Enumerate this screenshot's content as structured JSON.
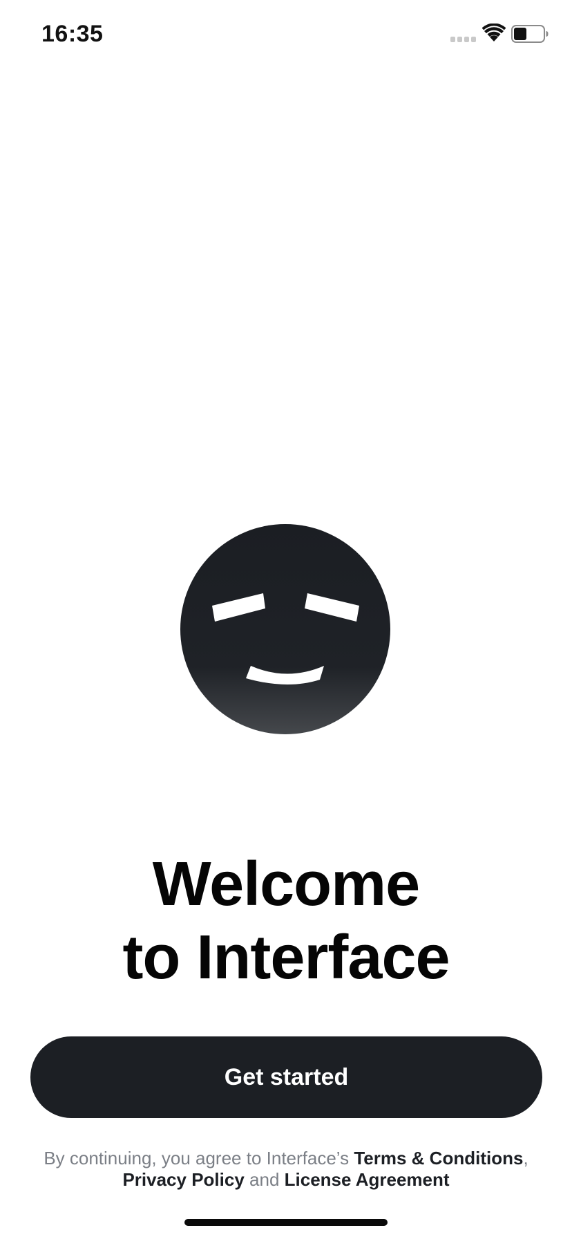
{
  "status_bar": {
    "time": "16:35",
    "signal_icon": "cellular-signal-icon",
    "wifi_icon": "wifi-icon",
    "battery_icon": "battery-icon",
    "battery_level": 0.45
  },
  "hero": {
    "mascot_icon": "smiling-face-icon",
    "title_line1": "Welcome",
    "title_line2": "to Interface"
  },
  "cta": {
    "label": "Get started"
  },
  "legal": {
    "prefix": "By continuing, you agree to Interface’s ",
    "terms": "Terms & Conditions",
    "sep1": ", ",
    "privacy": "Privacy Policy",
    "sep2": " and ",
    "license": "License Agreement"
  },
  "colors": {
    "primary_dark": "#1c1f24",
    "button_text": "#ffffff",
    "muted_text": "#7b7f86",
    "background": "#ffffff"
  }
}
